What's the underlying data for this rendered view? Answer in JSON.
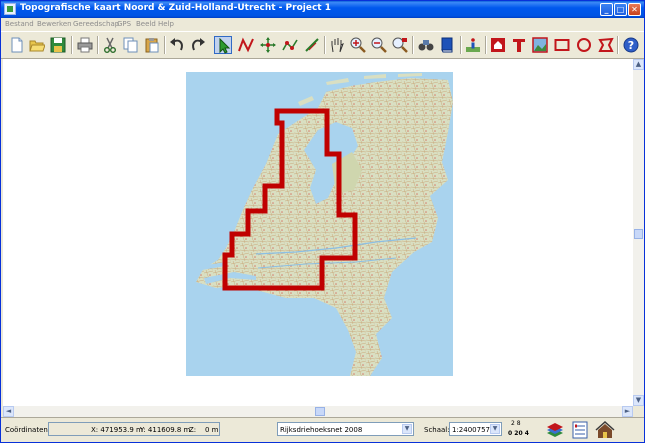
{
  "window": {
    "title": "Topografische kaart Noord & Zuid-Holland-Utrecht  - Project 1"
  },
  "title_buttons": {
    "minimize": "_",
    "maximize": "□",
    "close": "✕"
  },
  "menu": [
    "Bestand",
    "Bewerken",
    "Gereedschap",
    "GPS",
    "Beeld",
    "Help"
  ],
  "toolbar": {
    "tools": [
      "new-document-icon",
      "open-folder-icon",
      "save-icon",
      "print-icon",
      "cut-icon",
      "copy-icon",
      "paste-icon",
      "undo-icon",
      "redo-icon",
      "select-arrow-icon",
      "route-icon",
      "waypoint-move-icon",
      "track-edit-icon",
      "measure-icon",
      "pan-hand-icon",
      "zoom-in-icon",
      "zoom-out-icon",
      "zoom-area-icon",
      "gps-binoculars-icon",
      "book-icon",
      "info-icon",
      "waypoint-house-icon",
      "text-tool-icon",
      "image-tool-icon",
      "rectangle-tool-icon",
      "circle-tool-icon",
      "polygon-tool-icon",
      "help-icon"
    ],
    "active_tool": "select-arrow-icon"
  },
  "map": {
    "highlight_color": "#c00000",
    "sea_color": "#a9d3ee",
    "land_color": "#d9dfc2"
  },
  "scroll": {
    "up": "▲",
    "down": "▼",
    "left": "◄",
    "right": "►"
  },
  "status": {
    "coord_label": "Coördinaten:",
    "x": "X: 471953.9 m",
    "y": "Y: 411609.8 m",
    "z_label": "Z:",
    "z_value": "0 m",
    "grid_system": "Rijksdriehoeksnet 2008",
    "scale_label": "Schaal:",
    "scale_value": "1:2400757",
    "scale_bar_top": "2  8",
    "scale_bar_bottom": "0 20 4",
    "dropdown_arrow": "▼"
  }
}
